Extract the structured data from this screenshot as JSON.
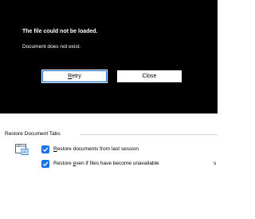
{
  "dialog": {
    "title": "The file could not be loaded.",
    "message": "Document does not exist.",
    "retry_prefix": "",
    "retry_mnemonic": "R",
    "retry_rest": "etry",
    "close_label": "Close"
  },
  "restore_group": {
    "label": "Restore Document Tabs",
    "icon": "document-tabs-icon",
    "options": [
      {
        "prefix": "",
        "mnemonic": "R",
        "rest": "estore documents from last session",
        "checked": true
      },
      {
        "prefix": "Restore ",
        "mnemonic": "e",
        "rest": "ven if files have become unavailable",
        "checked": true
      }
    ],
    "edge_text": "s"
  },
  "colors": {
    "dialog_bg": "#000000",
    "accent": "#1a73e8"
  }
}
